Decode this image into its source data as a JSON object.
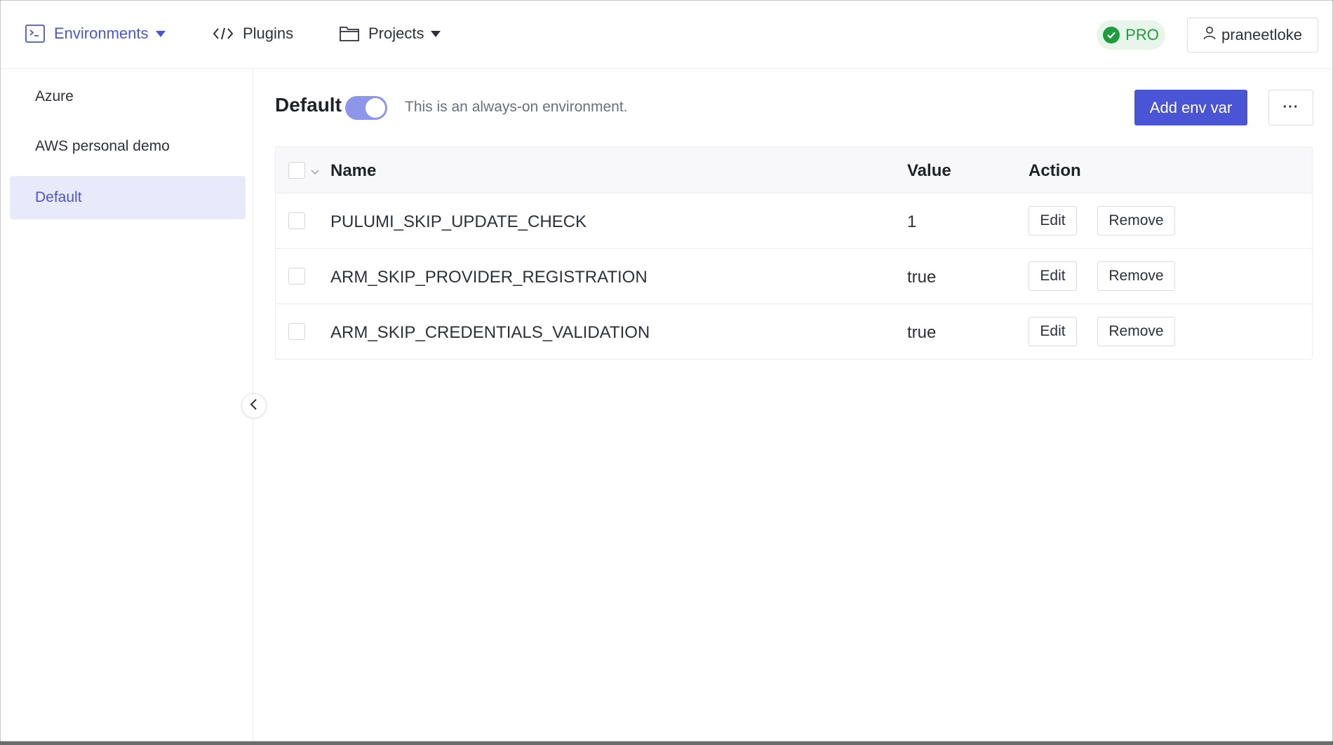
{
  "header": {
    "nav": [
      {
        "label": "Environments",
        "icon": "terminal-icon",
        "active": true,
        "dropdown": true
      },
      {
        "label": "Plugins",
        "icon": "code-arrows-icon",
        "active": false,
        "dropdown": false
      },
      {
        "label": "Projects",
        "icon": "folder-icon",
        "active": false,
        "dropdown": true
      }
    ],
    "pro_label": "PRO",
    "username": "praneetloke"
  },
  "sidebar": {
    "items": [
      {
        "label": "Azure",
        "active": false
      },
      {
        "label": "AWS personal demo",
        "active": false
      },
      {
        "label": "Default",
        "active": true
      }
    ]
  },
  "main": {
    "title": "Default",
    "toggle_on": true,
    "description": "This is an always-on environment.",
    "add_button": "Add env var",
    "more_button": "···"
  },
  "table": {
    "headers": {
      "name": "Name",
      "value": "Value",
      "action": "Action"
    },
    "rows": [
      {
        "name": "PULUMI_SKIP_UPDATE_CHECK",
        "value": "1",
        "edit": "Edit",
        "remove": "Remove"
      },
      {
        "name": "ARM_SKIP_PROVIDER_REGISTRATION",
        "value": "true",
        "edit": "Edit",
        "remove": "Remove"
      },
      {
        "name": "ARM_SKIP_CREDENTIALS_VALIDATION",
        "value": "true",
        "edit": "Edit",
        "remove": "Remove"
      }
    ]
  },
  "colors": {
    "accent": "#4a55d6",
    "pro_green": "#1f9d3c",
    "active_bg": "#e8eafb"
  }
}
